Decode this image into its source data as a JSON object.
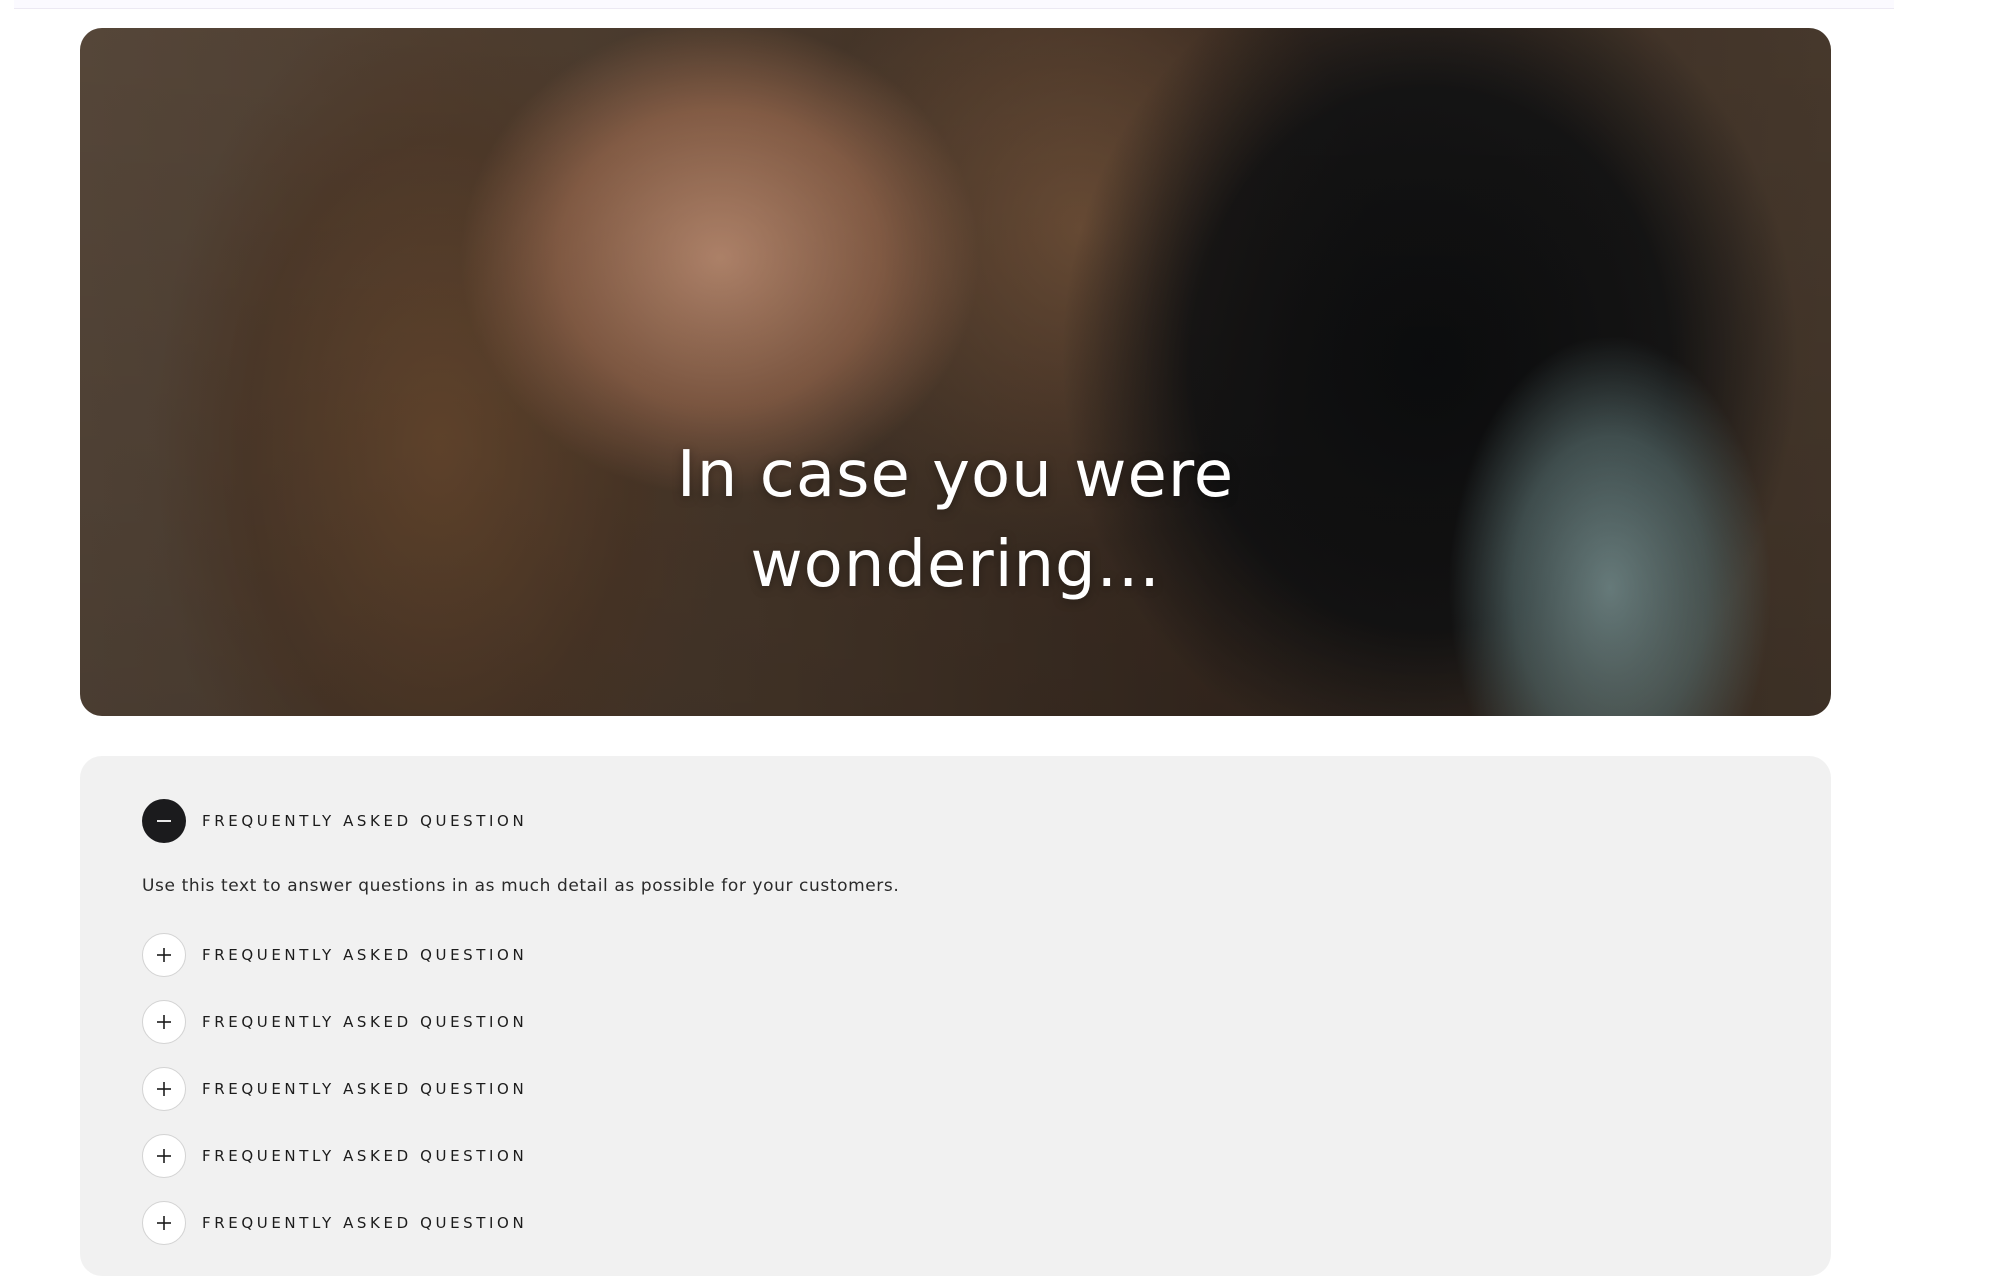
{
  "hero": {
    "title_line1": "In case you were",
    "title_line2": "wondering..."
  },
  "faq": {
    "items": [
      {
        "question": "FREQUENTLY ASKED QUESTION",
        "state": "open",
        "icon": "minus-icon",
        "answer": "Use this text to answer questions in as much detail as possible for your customers."
      },
      {
        "question": "FREQUENTLY ASKED QUESTION",
        "state": "closed",
        "icon": "plus-icon"
      },
      {
        "question": "FREQUENTLY ASKED QUESTION",
        "state": "closed",
        "icon": "plus-icon"
      },
      {
        "question": "FREQUENTLY ASKED QUESTION",
        "state": "closed",
        "icon": "plus-icon"
      },
      {
        "question": "FREQUENTLY ASKED QUESTION",
        "state": "closed",
        "icon": "plus-icon"
      },
      {
        "question": "FREQUENTLY ASKED QUESTION",
        "state": "closed",
        "icon": "plus-icon"
      }
    ]
  },
  "colors": {
    "panel_background": "#f1f1f1",
    "toggle_open": "#1b1b1d",
    "toggle_closed": "#ffffff",
    "hero_text": "#ffffff"
  }
}
